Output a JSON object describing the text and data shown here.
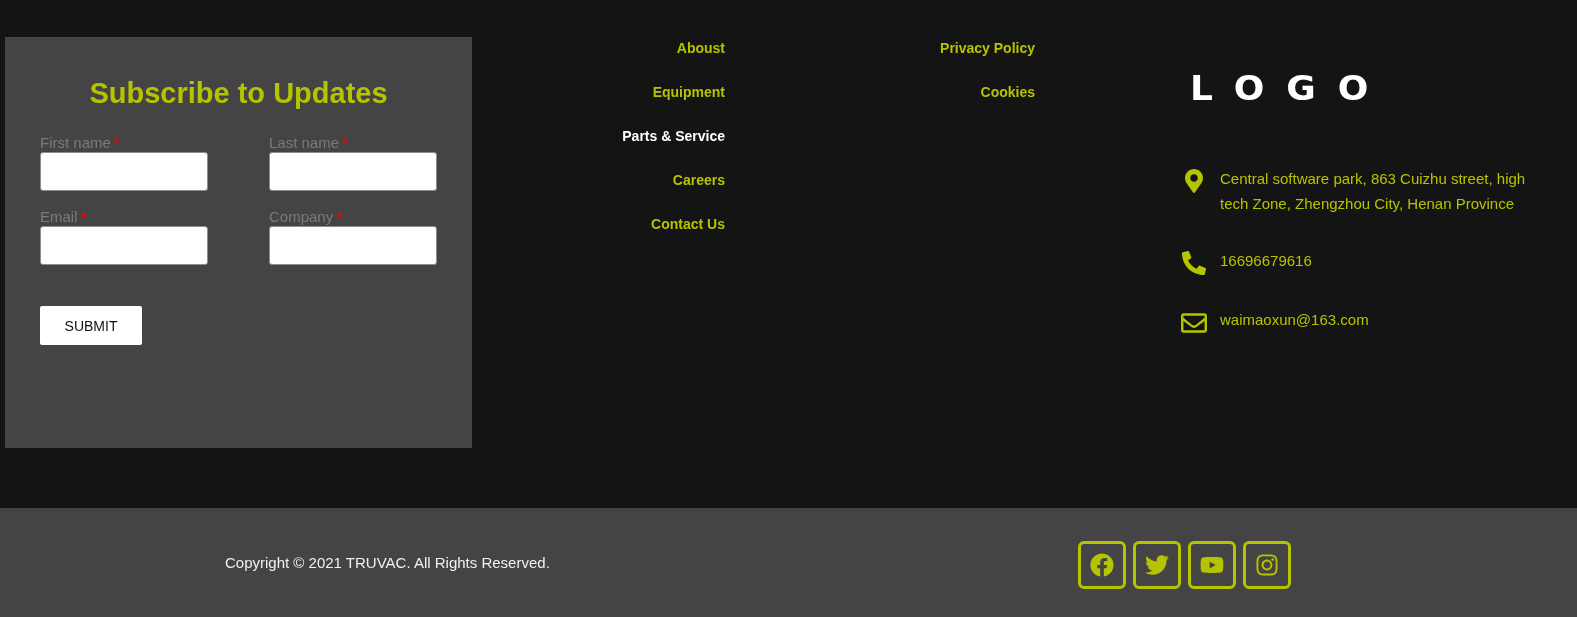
{
  "subscribe": {
    "title": "Subscribe to Updates",
    "fields": [
      {
        "label": "First name",
        "required_mark": "*"
      },
      {
        "label": "Last name",
        "required_mark": "*"
      },
      {
        "label": "Email",
        "required_mark": "*"
      },
      {
        "label": "Company",
        "required_mark": "*"
      }
    ],
    "submit": "SUBMIT"
  },
  "nav_main": [
    {
      "label": "Aboust",
      "selected": false
    },
    {
      "label": "Equipment",
      "selected": false
    },
    {
      "label": "Parts & Service",
      "selected": true
    },
    {
      "label": "Careers",
      "selected": false
    },
    {
      "label": "Contact Us",
      "selected": false
    }
  ],
  "nav_legal": [
    {
      "label": "Privacy Policy",
      "selected": false
    },
    {
      "label": "Cookies",
      "selected": false
    }
  ],
  "logo": "LOGO",
  "contacts": [
    {
      "kind": "address",
      "text": "Central software park, 863 Cuizhu street, high tech Zone, Zhengzhou City, Henan Province"
    },
    {
      "kind": "phone",
      "text": "16696679616"
    },
    {
      "kind": "email",
      "text": "waimaoxun@163.com"
    }
  ],
  "footer": {
    "copyright": "Copyright © 2021 TRUVAC. All Rights Reserved.",
    "social": [
      {
        "kind": "facebook"
      },
      {
        "kind": "twitter"
      },
      {
        "kind": "youtube"
      },
      {
        "kind": "instagram"
      }
    ]
  }
}
